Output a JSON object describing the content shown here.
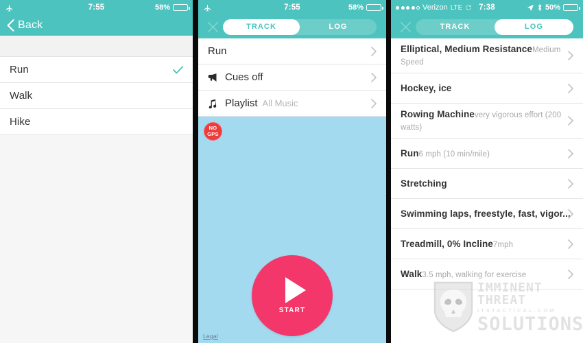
{
  "panel1": {
    "statusbar": {
      "airplane_icon": "airplane-icon",
      "time": "7:55",
      "battery_pct": "58%"
    },
    "navbar": {
      "back_label": "Back",
      "back_icon": "chevron-left-icon"
    },
    "activity_options": [
      {
        "label": "Run",
        "selected": true,
        "check_icon": "checkmark-icon"
      },
      {
        "label": "Walk",
        "selected": false,
        "check_icon": ""
      },
      {
        "label": "Hike",
        "selected": false,
        "check_icon": ""
      }
    ]
  },
  "panel2": {
    "statusbar": {
      "airplane_icon": "airplane-icon",
      "time": "7:55",
      "battery_pct": "58%"
    },
    "navbar": {
      "close_icon": "close-x-icon",
      "tabs": [
        {
          "label": "TRACK",
          "active": true
        },
        {
          "label": "LOG",
          "active": false
        }
      ]
    },
    "settings": [
      {
        "icon": "",
        "label": "Run",
        "value": "",
        "chevron": "chevron-right-icon"
      },
      {
        "icon": "megaphone-icon",
        "label": "Cues off",
        "value": "",
        "chevron": "chevron-right-icon"
      },
      {
        "icon": "music-note-icon",
        "label": "Playlist",
        "value": "All Music",
        "chevron": "chevron-right-icon"
      }
    ],
    "map": {
      "gps_badge_line1": "NO",
      "gps_badge_line2": "GPS",
      "start_label": "START",
      "start_icon": "play-triangle-icon",
      "legal_label": "Legal"
    }
  },
  "panel3": {
    "statusbar": {
      "carrier": "Verizon",
      "network": "LTE",
      "sync_icon": "sync-icon",
      "time": "7:38",
      "location_icon": "location-arrow-icon",
      "bluetooth_icon": "bluetooth-icon",
      "battery_pct": "50%"
    },
    "navbar": {
      "close_icon": "close-x-icon",
      "tabs": [
        {
          "label": "TRACK",
          "active": false
        },
        {
          "label": "LOG",
          "active": true
        }
      ]
    },
    "log_entries": [
      {
        "title": "Elliptical, Medium Resistance",
        "sub": "Medium Speed",
        "chevron": "chevron-right-icon"
      },
      {
        "title": "Hockey, ice",
        "sub": "",
        "chevron": "chevron-right-icon"
      },
      {
        "title": "Rowing Machine",
        "sub": "very vigorous effort (200 watts)",
        "chevron": "chevron-right-icon"
      },
      {
        "title": "Run",
        "sub": "6 mph (10 min/mile)",
        "chevron": "chevron-right-icon"
      },
      {
        "title": "Stretching",
        "sub": "",
        "chevron": "chevron-right-icon"
      },
      {
        "title": "Swimming laps, freestyle, fast, vigor...",
        "sub": "",
        "chevron": "chevron-right-icon"
      },
      {
        "title": "Treadmill, 0% Incline",
        "sub": "7mph",
        "chevron": "chevron-right-icon"
      },
      {
        "title": "Walk",
        "sub": "3.5 mph, walking for exercise",
        "chevron": "chevron-right-icon"
      }
    ]
  },
  "watermark": {
    "line1": "IMMINENT THREAT",
    "line2": "ITSTACTICAL.COM",
    "line3": "SOLUTIONS",
    "logo_icon": "skull-shield-icon"
  },
  "colors": {
    "teal": "#4cc3be",
    "pink": "#f3376a",
    "map_blue": "#a4daf0",
    "red_badge": "#ee3b3b",
    "divider": "#e4e4e4"
  }
}
